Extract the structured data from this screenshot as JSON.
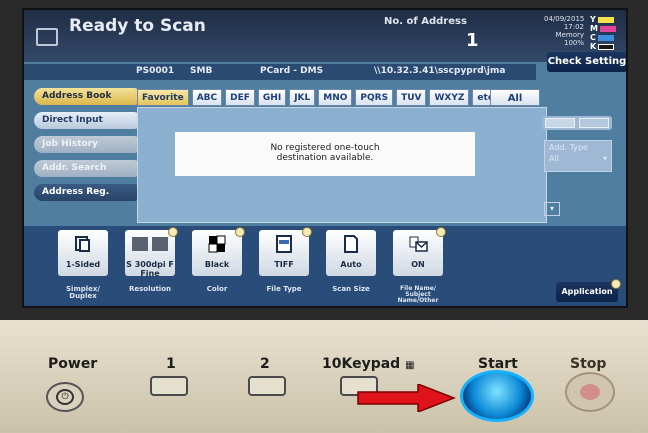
{
  "header": {
    "title": "Ready to Scan",
    "address_label": "No. of Address",
    "address_count": "1",
    "date": "04/09/2015",
    "time": "17:02",
    "memory_label": "Memory",
    "memory_value": "100%",
    "toner": [
      {
        "letter": "Y",
        "color": "#f5e24a"
      },
      {
        "letter": "M",
        "color": "#e0469a"
      },
      {
        "letter": "C",
        "color": "#3c8ee0"
      },
      {
        "letter": "K",
        "color": "#ffffff"
      }
    ],
    "check_setting": "Check Setting"
  },
  "info": {
    "port": "PS0001",
    "protocol": "SMB",
    "destination": "PCard - DMS",
    "path": "\\\\10.32.3.41\\sscpyprd\\jma"
  },
  "left_tabs": [
    "Address Book",
    "Direct Input",
    "Job History",
    "Addr. Search",
    "Address Reg."
  ],
  "alpha_tabs": [
    "Favorite",
    "ABC",
    "DEF",
    "GHI",
    "JKL",
    "MNO",
    "PQRS",
    "TUV",
    "WXYZ",
    "etc"
  ],
  "all_label": "All",
  "message": {
    "line1": "No registered one-touch",
    "line2": "destination available."
  },
  "addr_type": {
    "label": "Add. Type",
    "value": "All"
  },
  "functions": [
    {
      "value": "1-Sided",
      "label": "Simplex/ Duplex"
    },
    {
      "value": "S 300dpi F Fine",
      "label": "Resolution"
    },
    {
      "value": "Black",
      "label": "Color"
    },
    {
      "value": "TIFF",
      "label": "File Type"
    },
    {
      "value": "Auto",
      "label": "Scan Size"
    },
    {
      "value": "ON",
      "label": "File Name/ Subject Name/Other"
    }
  ],
  "application": "Application",
  "panel": {
    "power": "Power",
    "key1": "1",
    "key2": "2",
    "tenkey": "10Keypad",
    "start": "Start",
    "stop": "Stop"
  }
}
